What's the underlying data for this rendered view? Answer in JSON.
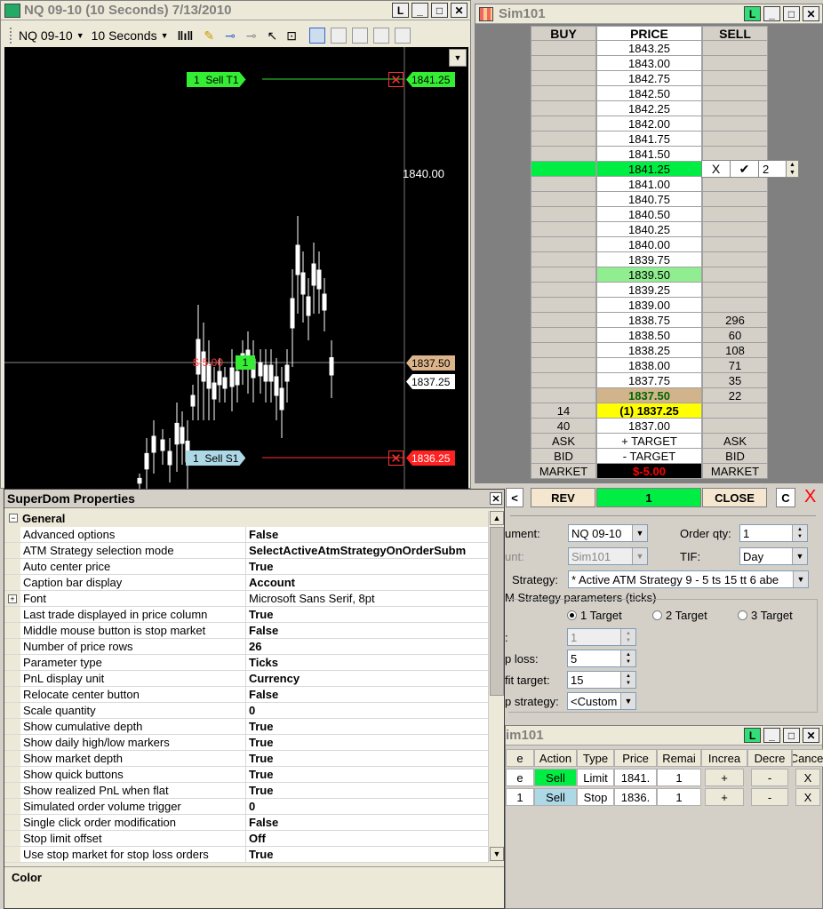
{
  "chart": {
    "title": "NQ 09-10 (10 Seconds)  7/13/2010",
    "instrument": "NQ 09-10",
    "interval": "10 Seconds",
    "price_label": "1840.00",
    "tags": {
      "target": {
        "qty": "1",
        "label": "Sell T1",
        "price": "1841.25"
      },
      "stop": {
        "qty": "1",
        "label": "Sell S1",
        "price": "1836.25"
      },
      "position": {
        "pnl": "$-5.00",
        "qty": "1",
        "price": "1837.50"
      },
      "last": "1837.25"
    }
  },
  "dom": {
    "title": "Sim101",
    "headers": {
      "buy": "BUY",
      "price": "PRICE",
      "sell": "SELL"
    },
    "rows": [
      {
        "buy": "",
        "price": "1843.25",
        "sell": ""
      },
      {
        "buy": "",
        "price": "1843.00",
        "sell": ""
      },
      {
        "buy": "",
        "price": "1842.75",
        "sell": ""
      },
      {
        "buy": "",
        "price": "1842.50",
        "sell": ""
      },
      {
        "buy": "",
        "price": "1842.25",
        "sell": ""
      },
      {
        "buy": "",
        "price": "1842.00",
        "sell": ""
      },
      {
        "buy": "",
        "price": "1841.75",
        "sell": ""
      },
      {
        "buy": "",
        "price": "1841.50",
        "sell": ""
      },
      {
        "buy": "",
        "price": "1841.25",
        "sell": ""
      },
      {
        "buy": "",
        "price": "1841.00",
        "sell": ""
      },
      {
        "buy": "",
        "price": "1840.75",
        "sell": ""
      },
      {
        "buy": "",
        "price": "1840.50",
        "sell": ""
      },
      {
        "buy": "",
        "price": "1840.25",
        "sell": ""
      },
      {
        "buy": "",
        "price": "1840.00",
        "sell": ""
      },
      {
        "buy": "",
        "price": "1839.75",
        "sell": ""
      },
      {
        "buy": "",
        "price": "1839.50",
        "sell": ""
      },
      {
        "buy": "",
        "price": "1839.25",
        "sell": ""
      },
      {
        "buy": "",
        "price": "1839.00",
        "sell": ""
      },
      {
        "buy": "",
        "price": "1838.75",
        "sell": "296"
      },
      {
        "buy": "",
        "price": "1838.50",
        "sell": "60"
      },
      {
        "buy": "",
        "price": "1838.25",
        "sell": "108"
      },
      {
        "buy": "",
        "price": "1838.00",
        "sell": "71"
      },
      {
        "buy": "",
        "price": "1837.75",
        "sell": "35"
      },
      {
        "buy": "",
        "price": "1837.50",
        "sell": "22"
      },
      {
        "buy": "14",
        "price": "(1) 1837.25",
        "sell": ""
      },
      {
        "buy": "40",
        "price": "1837.00",
        "sell": ""
      },
      {
        "buy": "ASK",
        "price": "+ TARGET",
        "sell": "ASK"
      },
      {
        "buy": "BID",
        "price": "- TARGET",
        "sell": "BID"
      },
      {
        "buy": "MARKET",
        "price": "$-5.00",
        "sell": "MARKET"
      }
    ],
    "order_edit": {
      "cancel": "X",
      "confirm": "✔",
      "qty": "2"
    },
    "controls": {
      "left": "<",
      "rev": "REV",
      "position": "1",
      "close": "CLOSE",
      "c": "C",
      "x": "X"
    },
    "colors": {
      "working": "#00ee44",
      "fill": "#90ee90",
      "last": "#d2b48c",
      "bid": "#ffff00",
      "pnl": "#ff0000"
    }
  },
  "order_entry": {
    "instrument_label": "ument:",
    "instrument_value": "NQ 09-10",
    "account_label": "unt:",
    "account_value": "Sim101",
    "qty_label": "Order qty:",
    "qty_value": "1",
    "tif_label": "TIF:",
    "tif_value": "Day",
    "strategy_label": "Strategy:",
    "strategy_value": "* Active ATM Strategy 9 - 5 ts  15 tt  6 abe",
    "group_label": "M Strategy parameters (ticks)",
    "targets": [
      "1 Target",
      "2 Target",
      "3 Target"
    ],
    "field1_label": ":",
    "field1_value": "1",
    "stop_label": "p loss:",
    "stop_value": "5",
    "profit_label": "fit target:",
    "profit_value": "15",
    "stopstrat_label": "p strategy:",
    "stopstrat_value": "<Custom"
  },
  "orders": {
    "title": "im101",
    "headers": [
      "e",
      "Action",
      "Type",
      "Price",
      "Remai",
      "Increa",
      "Decre",
      "Cancel"
    ],
    "rows": [
      {
        "name": "e",
        "action": "Sell",
        "type": "Limit",
        "price": "1841.",
        "remain": "1",
        "inc": "+",
        "dec": "-",
        "cancel": "X"
      },
      {
        "name": "1",
        "action": "Sell",
        "type": "Stop",
        "price": "1836.",
        "remain": "1",
        "inc": "+",
        "dec": "-",
        "cancel": "X"
      }
    ]
  },
  "props": {
    "title": "SuperDom Properties",
    "category": "General",
    "items": [
      {
        "k": "Advanced options",
        "v": "False"
      },
      {
        "k": "ATM Strategy selection mode",
        "v": "SelectActiveAtmStrategyOnOrderSubm"
      },
      {
        "k": "Auto center price",
        "v": "True"
      },
      {
        "k": "Caption bar display",
        "v": "Account"
      },
      {
        "k": "Font",
        "v": "Microsoft Sans Serif, 8pt"
      },
      {
        "k": "Last trade displayed in price column",
        "v": "True"
      },
      {
        "k": "Middle mouse button is stop market",
        "v": "False"
      },
      {
        "k": "Number of price rows",
        "v": "26"
      },
      {
        "k": "Parameter type",
        "v": "Ticks"
      },
      {
        "k": "PnL display unit",
        "v": "Currency"
      },
      {
        "k": "Relocate center button",
        "v": "False"
      },
      {
        "k": "Scale quantity",
        "v": "0"
      },
      {
        "k": "Show cumulative depth",
        "v": "True"
      },
      {
        "k": "Show daily high/low markers",
        "v": "True"
      },
      {
        "k": "Show market depth",
        "v": "True"
      },
      {
        "k": "Show quick buttons",
        "v": "True"
      },
      {
        "k": "Show realized PnL when flat",
        "v": "True"
      },
      {
        "k": "Simulated order volume trigger",
        "v": "0"
      },
      {
        "k": "Single click order modification",
        "v": "False"
      },
      {
        "k": "Stop limit offset",
        "v": "Off"
      },
      {
        "k": "Use stop market for stop loss orders",
        "v": "True"
      }
    ],
    "description": "Color"
  },
  "window_buttons": {
    "l": "L",
    "min": "_",
    "max": "□",
    "close": "✕"
  }
}
